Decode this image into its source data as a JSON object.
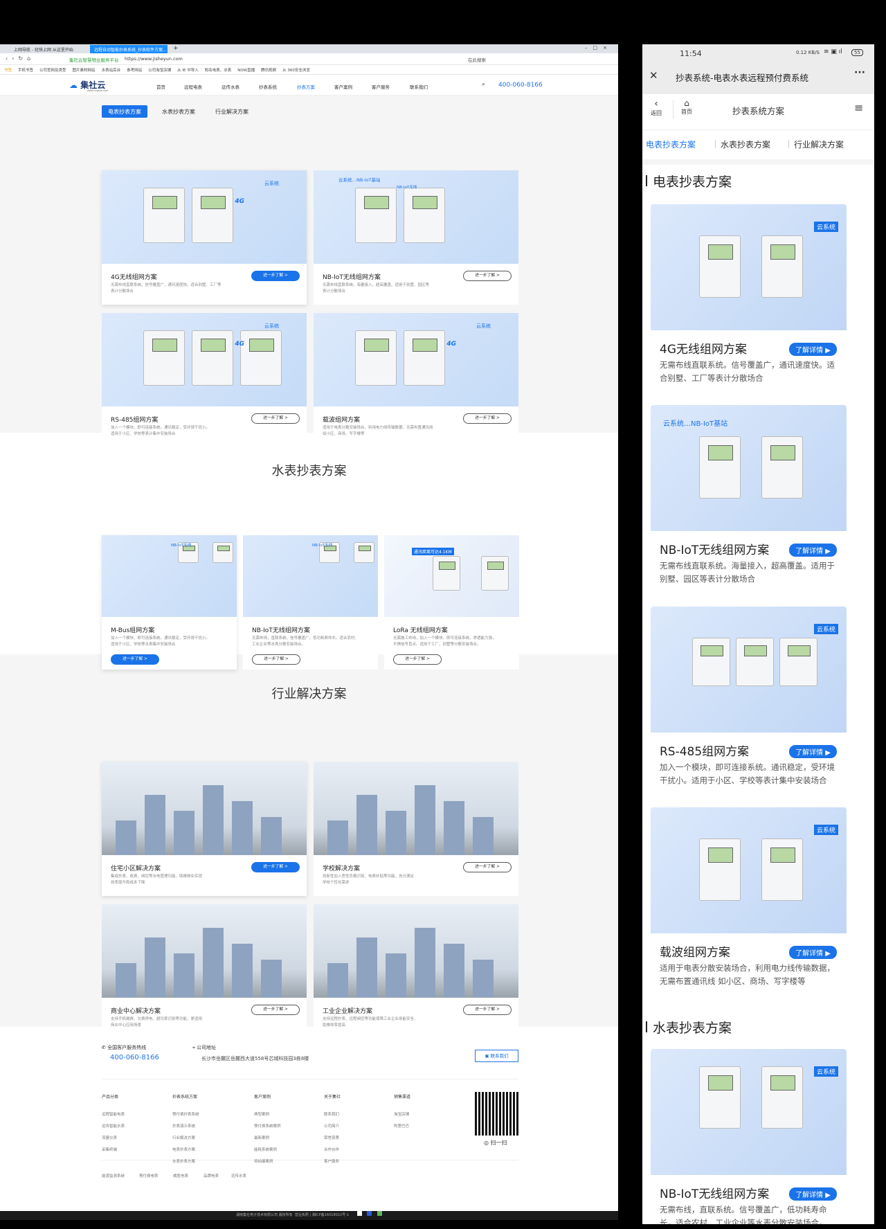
{
  "browser": {
    "tabs": [
      "上网导航 - 轻快上网 从这里开始",
      "远程自动智能抄表系统_抄表软件方案..."
    ],
    "url_site": "集社云智慧物业服务平台",
    "url": "https://www.jisheyun.com",
    "search": "在此搜索",
    "bookmarks": [
      "书签",
      "手机书签",
      "公司官网及类型",
      "图片素材网站",
      "水表站后台",
      "参考网站",
      "公司淘宝店铺",
      "从 IE 中导入",
      "知名电表、水表",
      "NOW直播",
      "腾讯视频",
      "从 360安全浏览"
    ]
  },
  "site": {
    "logo": "集社云",
    "logo_sub": "www.hnjishe.com",
    "nav": [
      "首页",
      "远程电表",
      "远传水表",
      "抄表系统",
      "抄表方案",
      "客户案例",
      "客户服务",
      "联系我们"
    ],
    "phone": "400-060-8166"
  },
  "tabs": [
    "电表抄表方案",
    "水表抄表方案",
    "行业解决方案"
  ],
  "more": "进一步了解 >",
  "electric": [
    {
      "title": "4G无线组网方案",
      "desc": [
        "无需布线直联系统。信号覆盖广，通讯速度快。适合别墅、工厂等",
        "表计分散场合"
      ]
    },
    {
      "title": "NB-IoT无线组网方案",
      "desc": [
        "无需布线直联系统。海量接入，超高覆盖。适用于别墅、园区等",
        "表计分散场合"
      ]
    },
    {
      "title": "RS-485组网方案",
      "desc": [
        "加入一个模块，即可连接系统。通讯稳定，受环境干扰小。",
        "适用于小区、学校等表计集中安装场合"
      ]
    },
    {
      "title": "载波组网方案",
      "desc": [
        "适用于电表分散安装场合，利用电力线传输数据，无需布置通讯线",
        "如小区、商场、写字楼等"
      ]
    }
  ],
  "img_labels": {
    "cloud": "云系统",
    "g4": "4G",
    "nb_station": "云系统…NB-IoT基站",
    "nb": "NB-IoT无线",
    "lora": "通讯距离可达4.1KM"
  },
  "water_heading": "水表抄表方案",
  "water": [
    {
      "title": "M-Bus组网方案",
      "desc": [
        "加入一个模块，即可连接系统。通讯稳定，受环境干扰小。",
        "适用于小区、学校等水表集中安装场合"
      ]
    },
    {
      "title": "NB-IoT无线组网方案",
      "desc": [
        "无需布线，直联系统。信号覆盖广，低功耗寿命长。适合农村、",
        "工业企业等水表分散安装场合。"
      ]
    },
    {
      "title": "LoRa 无线组网方案",
      "desc": [
        "无需施工布线，加入一个模块，即可连接系统。渗透能力强，",
        "不惧信号盲点。适用于工厂、别墅等分散安装场合。"
      ]
    }
  ],
  "industry_heading": "行业解决方案",
  "industry": [
    {
      "title": "住宅小区解决方案",
      "desc": [
        "集成抄表、收费、阀控等水电管理功能，助推物业实现",
        "效率提升和成本下降"
      ]
    },
    {
      "title": "学校解决方案",
      "desc": [
        "创新性加入恶性负载识别、电费补贴等功能，充分满足",
        "学校个性化需求"
      ]
    },
    {
      "title": "商业中心解决方案",
      "desc": [
        "支持手机缴费、欠费停电、超功率识别等功能，更适用",
        "商业中心应用场景"
      ]
    },
    {
      "title": "工业企业解决方案",
      "desc": [
        "支持远程抄表、远程阀控等功能保障工业企业用能安全、",
        "助推效率提高"
      ]
    }
  ],
  "footer": {
    "hotline_label": "全国客户服务热线",
    "hotline": "400-060-8166",
    "addr_label": "公司地址",
    "addr": "长沙市岳麓区岳麓西大道558号芯城科技园3栋8楼",
    "contact": "联系我们",
    "cols": [
      {
        "h": "产品分类",
        "items": [
          "远程智能电表",
          "远传智能水表",
          "流量仪表",
          "采集终端"
        ]
      },
      {
        "h": "抄表系统方案",
        "items": [
          "预付费抄表系统",
          "抄表演示系统",
          "行业解决方案",
          "电表抄表方案",
          "水表抄表方案"
        ]
      },
      {
        "h": "客户案例",
        "items": [
          "典型案例",
          "预付费系统案例",
          "最新案例",
          "能耗系统案例",
          "待拍摄案例"
        ]
      },
      {
        "h": "关于集社",
        "items": [
          "联系我们",
          "公司简介",
          "荣誉资质",
          "合作伙伴",
          "客户服务"
        ]
      },
      {
        "h": "销售渠道",
        "items": [
          "淘宝店铺",
          "阿里巴巴"
        ]
      }
    ],
    "scan": "扫一扫",
    "links": [
      "能源监测系统",
      "预付费电表",
      "威胜电表",
      "品牌电表",
      "远传水表"
    ],
    "copyright": "湖南集社电子技术有限公司 版权所有",
    "license": "营业执照",
    "icp": "湘ICP备16018022号-1"
  },
  "mobile": {
    "time": "11:54",
    "net": "0.12 KB/S",
    "battery": "55",
    "title": "抄表系统-电表水表远程预付费系统",
    "back": "返回",
    "home": "首页",
    "page_title": "抄表系统方案",
    "tabs": [
      "电表抄表方案",
      "水表抄表方案",
      "行业解决方案"
    ],
    "heading1": "电表抄表方案",
    "heading2": "水表抄表方案",
    "detail": "了解详情 ▶",
    "cards": [
      {
        "title": "4G无线组网方案",
        "desc": "无需布线直联系统。信号覆盖广，通讯速度快。适合别墅、工厂等表计分散场合"
      },
      {
        "title": "NB-IoT无线组网方案",
        "desc": "无需布线直联系统。海量接入，超高覆盖。适用于别墅、园区等表计分散场合"
      },
      {
        "title": "RS-485组网方案",
        "desc": "加入一个模块，即可连接系统。通讯稳定，受环境干扰小。适用于小区、学校等表计集中安装场合"
      },
      {
        "title": "载波组网方案",
        "desc": "适用于电表分散安装场合，利用电力线传输数据，无需布置通讯线 如小区、商场、写字楼等"
      },
      {
        "title": "NB-IoT无线组网方案",
        "desc": "无需布线，直联系统。信号覆盖广，低功耗寿命长。适合农村、工业企业等水表分散安装场合。"
      }
    ]
  },
  "colors": {
    "accent": "#1a73e8",
    "footer_bar": "#1b1b1b"
  }
}
